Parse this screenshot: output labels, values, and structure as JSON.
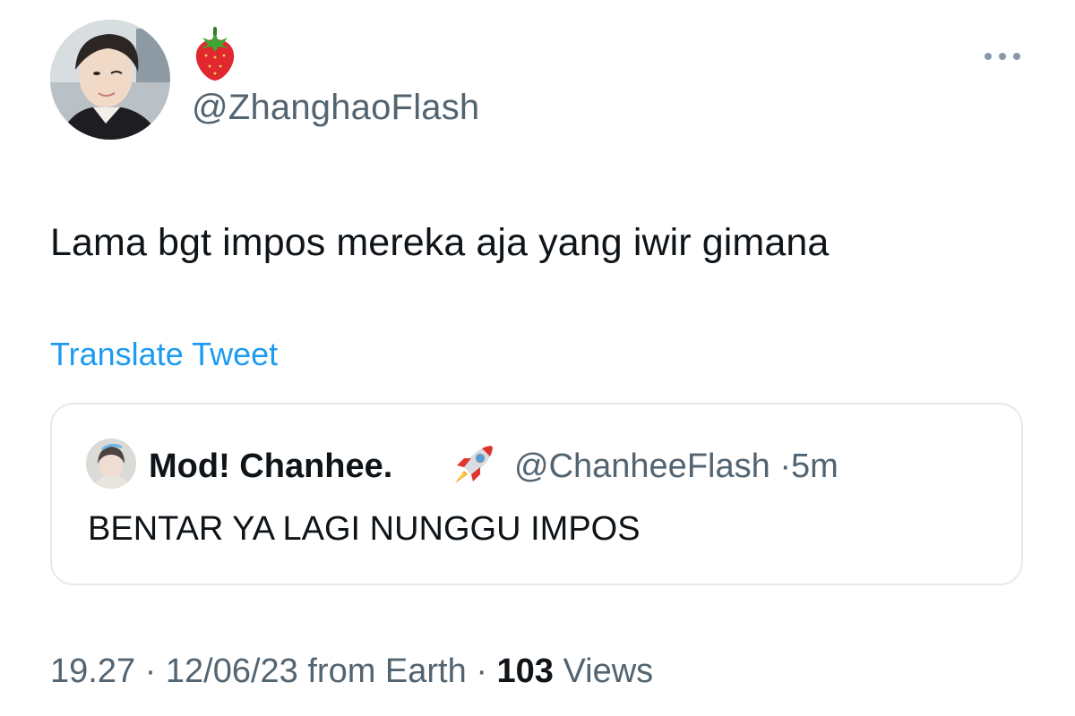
{
  "author": {
    "display_emoji": "strawberry-emoji",
    "handle": "@ZhanghaoFlash",
    "avatar": "profile-photo"
  },
  "more_icon": "more-horizontal-icon",
  "tweet": {
    "text": "Lama bgt impos mereka aja yang iwir gimana",
    "translate_label": "Translate Tweet"
  },
  "quoted_tweet": {
    "avatar": "profile-photo",
    "display_name": "Mod! Chanhee.",
    "name_emoji": "rocket-emoji",
    "handle": "@ChanheeFlash",
    "separator": "·",
    "time": "5m",
    "text": "BENTAR YA LAGI NUNGGU IMPOS"
  },
  "meta": {
    "time": "19.27",
    "separator": "·",
    "date": "12/06/23",
    "source": "from Earth",
    "views_count": "103",
    "views_label": "Views"
  },
  "colors": {
    "text_primary": "#0f1419",
    "text_secondary": "#536471",
    "link": "#1d9bf0",
    "border": "#e6e9eb"
  }
}
